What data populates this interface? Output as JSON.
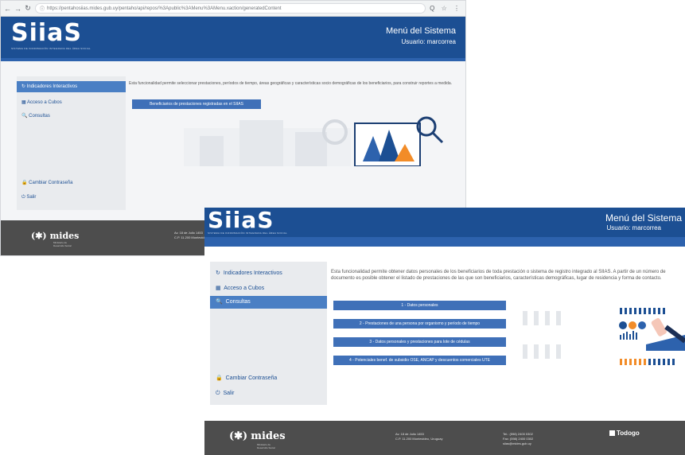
{
  "browser": {
    "url": "https://pentahosiias.mides.gub.uy/pentaho/api/repos/%3Apublic%3AMenu%3AMenu.xaction/generatedContent",
    "zoom_icons": "Q ☆ ⋮"
  },
  "back_page": {
    "logo": "SiiaS",
    "logo_sub": "SISTEMA DE INFORMACIÓN INTEGRADA DEL ÁREA SOCIAL",
    "menu_title": "Menú del Sistema",
    "user_label": "Usuario: marcorrea",
    "sidebar": [
      {
        "label": "Indicadores Interactivos",
        "icon": "↻"
      },
      {
        "label": "Acceso a Cubos",
        "icon": "▦"
      },
      {
        "label": "Consultas",
        "icon": "🔍"
      }
    ],
    "sidebar_bottom": [
      {
        "label": "Cambiar Contraseña",
        "icon": "🔒"
      },
      {
        "label": "Salir",
        "icon": "⏻"
      }
    ],
    "description": "Esta funcionalidad permite seleccionar prestaciones, períodos de tiempo, áreas geográficas y características socio demográficas de los beneficiarios, para construir reportes a medida.",
    "button": "Beneficiarios de prestaciones registradas en el SIIAS",
    "footer": {
      "brand": "mides",
      "brand_sub1": "Ministerio de",
      "brand_sub2": "Desarrollo Social",
      "addr1": "Av. 18 de Julio 1453",
      "addr2": "C.P. 11.200 Montevideo"
    }
  },
  "front_page": {
    "logo": "SiiaS",
    "logo_sub": "SISTEMA DE INFORMACIÓN INTEGRADA DEL ÁREA SOCIAL",
    "menu_title": "Menú del Sistema",
    "user_label": "Usuario: marcorrea",
    "sidebar": [
      {
        "label": "Indicadores Interactivos",
        "icon": "↻"
      },
      {
        "label": "Acceso a Cubos",
        "icon": "▦"
      },
      {
        "label": "Consultas",
        "icon": "🔍"
      }
    ],
    "sidebar_bottom": [
      {
        "label": "Cambiar Contraseña",
        "icon": "🔒"
      },
      {
        "label": "Salir",
        "icon": "⏻"
      }
    ],
    "description": "Esta funcionalidad permite obtener datos personales de los beneficiarios de toda prestación o sistema de registro integrado al SIIAS. A partir de un número de documento es posible obtener el listado de prestaciones de las que son beneficiarios, características demográficas, lugar de residencia y forma de contacto.",
    "buttons": [
      "1 - Datos personales",
      "2 - Prestaciones de una persona por organismo y período de tiempo",
      "3 - Datos personales y prestaciones para lote de cédulas",
      "4 - Potenciales benef. de subsidio OSE, ANCAP y descuentos comerciales UTE"
    ],
    "footer": {
      "brand": "mides",
      "brand_sub1": "Ministerio de",
      "brand_sub2": "Desarrollo Social",
      "addr1": "Av. 18 de Julio 1453",
      "addr2": "C.P. 11.200 Montevideo, Uruguay",
      "tel": "Tel.: (598) 2400 0302",
      "fax": "Fax: (598) 2400 0302",
      "email": "siias@mides.gub.uy",
      "partner": "Todogo"
    }
  },
  "colors": {
    "header_blue": "#1c4f93",
    "accent_blue": "#3f70b8",
    "active_item": "#4a7fc4",
    "footer_gray": "#4d4d4d",
    "sidebar_bg": "#e9ebee"
  }
}
